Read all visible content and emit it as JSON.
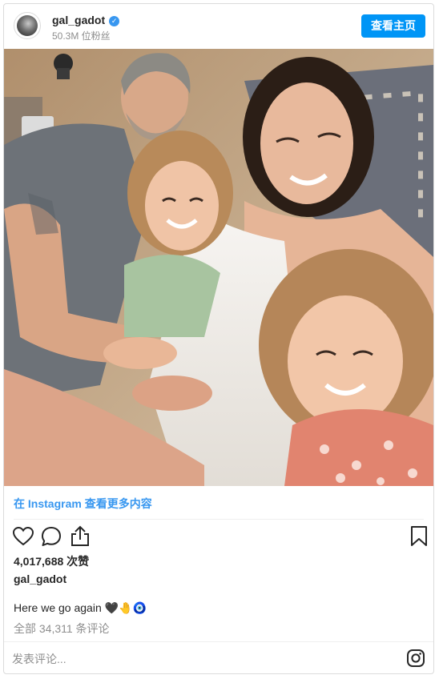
{
  "header": {
    "username": "gal_gadot",
    "verified_icon": "verified-badge-icon",
    "followers": "50.3M 位粉丝",
    "profile_button": "查看主页"
  },
  "photo": {
    "alt": ""
  },
  "view_more": "在 Instagram 查看更多内容",
  "actions": {
    "icons": [
      "heart-icon",
      "comment-icon",
      "share-icon",
      "bookmark-icon"
    ]
  },
  "likes": "4,017,688 次赞",
  "caption": {
    "username": "gal_gadot",
    "text": "Here we go again 🖤🤚🧿"
  },
  "comments_link": "全部 34,311 条评论",
  "comment_input": {
    "placeholder": "发表评论..."
  },
  "colors": {
    "link": "#3897f0",
    "button": "#0095f6",
    "muted": "#8e8e8e",
    "border": "#dbdbdb"
  }
}
